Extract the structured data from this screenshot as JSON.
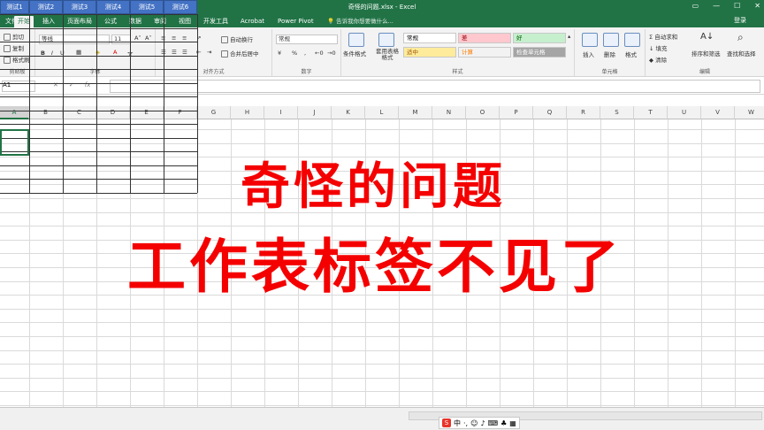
{
  "window": {
    "title": "奇怪的问题.xlsx - Excel",
    "signin": "登录"
  },
  "tabs": [
    "文件",
    "开始",
    "插入",
    "页面布局",
    "公式",
    "数据",
    "审阅",
    "视图",
    "开发工具",
    "Acrobat",
    "Power Pivot"
  ],
  "tell_me": "告诉我你想要做什么...",
  "ribbon": {
    "clipboard": {
      "cut": "剪切",
      "copy": "复制",
      "format_painter": "格式刷",
      "label": "剪贴板"
    },
    "font": {
      "name": "等线",
      "size": "11",
      "label": "字体",
      "bold": "B",
      "italic": "I",
      "underline": "U"
    },
    "alignment": {
      "wrap": "自动换行",
      "merge": "合并后居中",
      "label": "对齐方式"
    },
    "number": {
      "format": "常规",
      "label": "数字",
      "percent": "%"
    },
    "styles": {
      "cond_format": "条件格式",
      "table_format": "套用表格格式",
      "label": "样式",
      "cells": [
        {
          "text": "常规",
          "bg": "#ffffff",
          "fg": "#000000"
        },
        {
          "text": "差",
          "bg": "#ffc7ce",
          "fg": "#9c0006"
        },
        {
          "text": "好",
          "bg": "#c6efce",
          "fg": "#006100"
        },
        {
          "text": "适中",
          "bg": "#ffeb9c",
          "fg": "#9c5700"
        },
        {
          "text": "计算",
          "bg": "#f2f2f2",
          "fg": "#fa7d00"
        },
        {
          "text": "检查单元格",
          "bg": "#a5a5a5",
          "fg": "#ffffff"
        }
      ]
    },
    "cells": {
      "insert": "插入",
      "delete": "删除",
      "format": "格式",
      "label": "单元格"
    },
    "editing": {
      "autosum": "自动求和",
      "fill": "填充",
      "clear": "清除",
      "sort": "排序和筛选",
      "find": "查找和选择",
      "label": "编辑"
    }
  },
  "formula_bar": {
    "name_box": "A1",
    "fx": "fx"
  },
  "columns": [
    "A",
    "B",
    "C",
    "D",
    "E",
    "F",
    "G",
    "H",
    "I",
    "J",
    "K",
    "L",
    "M",
    "N",
    "O",
    "P",
    "Q",
    "R",
    "S",
    "T",
    "U",
    "V",
    "W"
  ],
  "table_headers": [
    "测试1",
    "测试2",
    "测试3",
    "测试4",
    "测试5",
    "测试6"
  ],
  "overlay": {
    "line1": "奇怪的问题",
    "line2": "工作表标签不见了"
  },
  "ime": {
    "label": "中"
  },
  "colors": {
    "excel_green": "#217346",
    "header_blue": "#4472c4",
    "overlay_red": "#f40000"
  }
}
